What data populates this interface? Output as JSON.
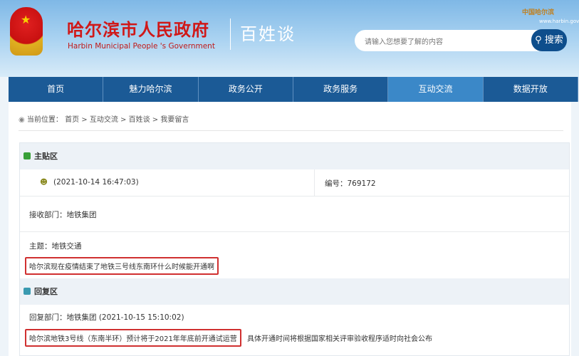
{
  "header": {
    "title_cn": "哈尔滨市人民政府",
    "title_en": "Harbin Municipal People 's Government",
    "slogan": "百姓谈",
    "search_placeholder": "请输入您想要了解的内容",
    "search_button": "搜索",
    "gov_logo": "中国哈尔滨",
    "gov_url": "www.harbin.gov.cn"
  },
  "nav": [
    "首页",
    "魅力哈尔滨",
    "政务公开",
    "政务服务",
    "互动交流",
    "数据开放"
  ],
  "breadcrumb": {
    "label": "当前位置：",
    "path": "首页 > 互动交流 > 百姓谈 > 我要留言"
  },
  "main_post": {
    "section": "主贴区",
    "time": "(2021-10-14 16:47:03)",
    "number": "编号：769172",
    "dept": "接收部门：地铁集团",
    "topic": "主题：地铁交通",
    "content": "哈尔滨现在疫情结束了地铁三号线东南环什么时候能开通啊"
  },
  "reply": {
    "section": "回复区",
    "dept": "回复部门：地铁集团 (2021-10-15 15:10:02)",
    "content_highlight": "哈尔滨地铁3号线（东南半环）预计将于2021年年底前开通试运营",
    "content_rest": "具体开通时间将根据国家相关评审验收程序适时向社会公布"
  }
}
